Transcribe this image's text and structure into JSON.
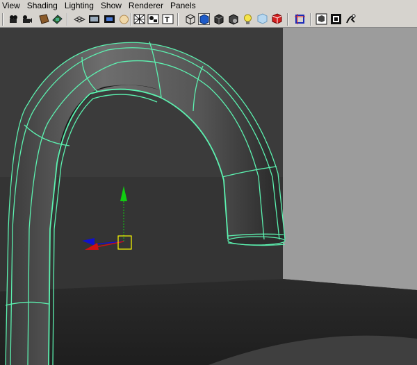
{
  "menubar": {
    "items": [
      "View",
      "Shading",
      "Lighting",
      "Show",
      "Renderer",
      "Panels"
    ]
  },
  "toolbar": {
    "icons": [
      "select-camera-icon",
      "camera-attributes-icon",
      "bookmark-icon",
      "image-plane-icon",
      "grid-icon",
      "film-gate-icon",
      "resolution-gate-icon",
      "field-chart-icon",
      "safe-action-icon",
      "safe-title-icon",
      "textured-icon",
      "wireframe-icon",
      "smooth-shade-icon",
      "flat-shade-icon",
      "lights-icon",
      "xray-icon",
      "backface-icon",
      "isolate-select-icon",
      "shadows-icon",
      "frame-all-icon",
      "frame-selection-icon",
      "uv-editor-icon"
    ]
  },
  "colors": {
    "wire": "#5cf2b0",
    "background": "#343434",
    "manip_y": "#11cc11",
    "manip_x": "#cc1111",
    "manip_z": "#1111cc",
    "pivot": "#ffff00"
  }
}
